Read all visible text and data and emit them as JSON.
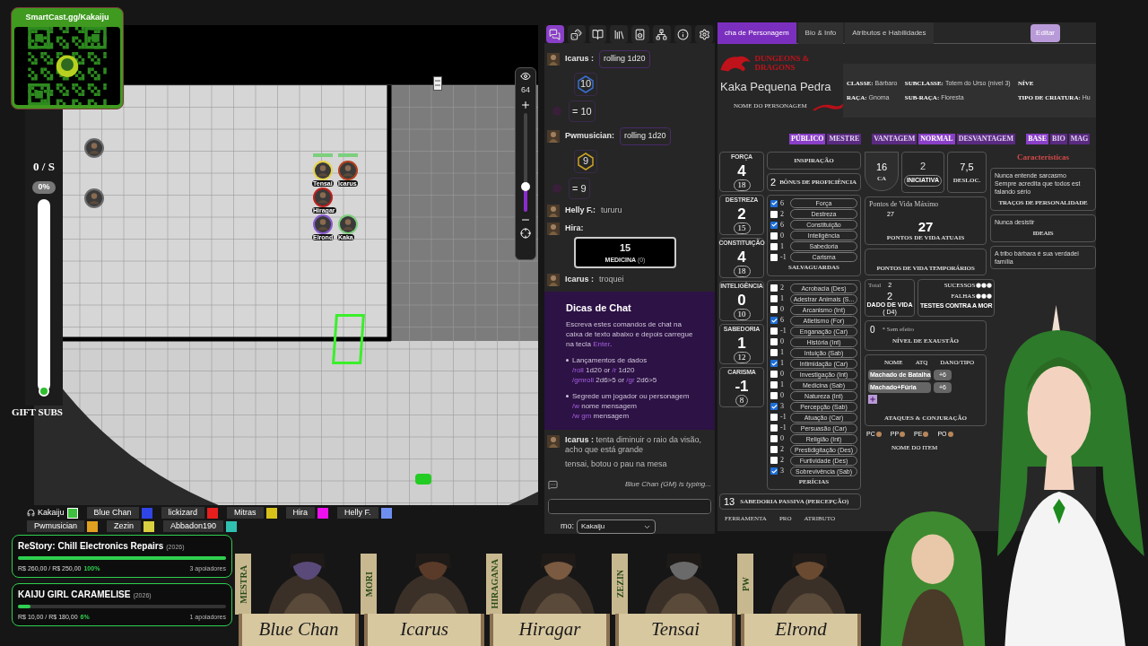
{
  "qr_card": {
    "title": "SmartCast.gg/Kakaiju"
  },
  "map": {
    "tokens": [
      {
        "color": "#6b6b6b"
      },
      {
        "color": "#6b6b6b"
      },
      {
        "color": "#e8d44a",
        "label": "Tensai"
      },
      {
        "color": "#b0401c",
        "label": "Icarus"
      },
      {
        "color": "#c0201c",
        "label": "Hiragar"
      },
      {
        "color": "#8a5ad0",
        "label": "Elrond"
      },
      {
        "color": "#7fd07f",
        "label": "Kaka"
      }
    ],
    "zoom": {
      "value": "64",
      "level": 0.25
    }
  },
  "left_overlay": {
    "counter": "0 / S",
    "percent": "0%",
    "gift_label": "GIFT SUBS",
    "level": 0
  },
  "chat": {
    "toolbar_tabs": [
      {
        "selected": true
      },
      {
        "selected": false
      },
      {
        "selected": false
      },
      {
        "selected": false
      },
      {
        "selected": false
      },
      {
        "selected": false
      },
      {
        "selected": false
      },
      {
        "selected": false
      }
    ],
    "messages": [
      {
        "kind": "roll",
        "author": "Icarus :",
        "text": "rolling 1d20",
        "die": "10",
        "result": "= 10"
      },
      {
        "kind": "roll",
        "author": "Pwmusician:",
        "text": "rolling 1d20",
        "die": "9",
        "result": "= 9"
      },
      {
        "kind": "text",
        "author": "Helly F.:",
        "text": "tururu"
      },
      {
        "kind": "card",
        "author": "Hira:",
        "value": "15",
        "label": "MEDICINA",
        "mod": "(0)"
      },
      {
        "kind": "text",
        "author": "Icarus :",
        "text": "troquei"
      }
    ],
    "tips": {
      "title": "Dicas de Chat",
      "intro": [
        {
          "text": "Escreva estes comandos de chat na caixa de texto abaixo e depois carregue na tecla ",
          "cmd": false
        },
        {
          "text": "Enter",
          "cmd": true
        },
        {
          "text": ".",
          "cmd": false
        }
      ],
      "bullets": [
        {
          "title": "Lançamentos de dados",
          "lines": [
            [
              {
                "text": "/roll",
                "cmd": true
              },
              {
                "text": " 1d20 or ",
                "cmd": false
              },
              {
                "text": "/r",
                "cmd": true
              },
              {
                "text": " 1d20",
                "cmd": false
              }
            ],
            [
              {
                "text": "/gmroll",
                "cmd": true
              },
              {
                "text": " 2d6>5 or ",
                "cmd": false
              },
              {
                "text": "/gr",
                "cmd": true
              },
              {
                "text": " 2d6>5",
                "cmd": false
              }
            ]
          ]
        },
        {
          "title": "Segrede um jogador ou personagem",
          "lines": [
            [
              {
                "text": "/w",
                "cmd": true
              },
              {
                "text": " nome mensagem",
                "cmd": false
              }
            ],
            [
              {
                "text": "/w gm",
                "cmd": true
              },
              {
                "text": " mensagem",
                "cmd": false
              }
            ]
          ]
        }
      ]
    },
    "last_message": {
      "author": "Icarus :",
      "lines": [
        "tenta diminuir o raio da visão, acho que está grande",
        "tensai, botou o pau na mesa"
      ]
    },
    "typing": "Blue Chan (GM) is typing...",
    "as_label": "mo:",
    "as_value": "Kakaiju"
  },
  "sheet": {
    "tabs": [
      {
        "label": "cha de Personagem",
        "selected": true
      },
      {
        "label": "Bio & Info",
        "selected": false
      },
      {
        "label": "Atributos e Habilidades",
        "selected": false
      }
    ],
    "edit_button": "Editar",
    "logo": "DUNGEONS & DRAGONS",
    "character_name": "Kaka Pequena Pedra",
    "character_name_label": "NOME DO PERSONAGEM",
    "info": [
      {
        "label": "CLASSE:",
        "value": "Bárbaro"
      },
      {
        "label": "SUBCLASSE:",
        "value": "Totem do Urso (nível 3)"
      },
      {
        "label": "NÍVE"
      },
      {
        "label": "RAÇA:",
        "value": "Gnoma"
      },
      {
        "label": "SUB-RAÇA:",
        "value": "Floresta"
      },
      {
        "label": "TIPO DE CRIATURA:",
        "value": "Hu"
      }
    ],
    "toggles": [
      {
        "label": "PÚBLICO",
        "selected": true
      },
      {
        "label": "MESTRE",
        "selected": false
      },
      {
        "label": "VANTAGEM",
        "selected": false
      },
      {
        "label": "NORMAL",
        "selected": true
      },
      {
        "label": "DESVANTAGEM",
        "selected": false
      },
      {
        "label": "BASE",
        "selected": true
      },
      {
        "label": "BIO",
        "selected": false
      },
      {
        "label": "MAG",
        "selected": false
      }
    ],
    "abilities": [
      {
        "name": "FORÇA",
        "mod": "4",
        "score": "18"
      },
      {
        "name": "DESTREZA",
        "mod": "2",
        "score": "15"
      },
      {
        "name": "CONSTITUIÇÃO",
        "mod": "4",
        "score": "18"
      },
      {
        "name": "INTELIGÊNCIA",
        "mod": "0",
        "score": "10"
      },
      {
        "name": "SABEDORIA",
        "mod": "1",
        "score": "12"
      },
      {
        "name": "CARISMA",
        "mod": "-1",
        "score": "8"
      }
    ],
    "inspiration": "INSPIRAÇÃO",
    "proficiency": {
      "value": "2",
      "label": "BÔNUS DE PROFICIÊNCIA"
    },
    "saves": [
      {
        "value": "6",
        "name": "Força",
        "checked": true
      },
      {
        "value": "2",
        "name": "Destreza",
        "checked": false
      },
      {
        "value": "6",
        "name": "Constituição",
        "checked": true
      },
      {
        "value": "0",
        "name": "Inteligência",
        "checked": false
      },
      {
        "value": "1",
        "name": "Sabedoria",
        "checked": false
      },
      {
        "value": "-1",
        "name": "Carisma",
        "checked": false
      }
    ],
    "saves_label": "SALVAGUARDAS",
    "skills": [
      {
        "value": "2",
        "name": "Acrobacia (Des)",
        "checked": false
      },
      {
        "value": "1",
        "name": "Adestrar Animais (S...",
        "checked": false
      },
      {
        "value": "0",
        "name": "Arcanismo (Int)",
        "checked": false
      },
      {
        "value": "6",
        "name": "Atletismo (For)",
        "checked": true
      },
      {
        "value": "-1",
        "name": "Enganação (Car)",
        "checked": false
      },
      {
        "value": "0",
        "name": "História (Int)",
        "checked": false
      },
      {
        "value": "1",
        "name": "Intuição (Sab)",
        "checked": false
      },
      {
        "value": "1",
        "name": "Intimidação (Car)",
        "checked": true
      },
      {
        "value": "0",
        "name": "Investigação (Int)",
        "checked": false
      },
      {
        "value": "1",
        "name": "Medicina (Sab)",
        "checked": false
      },
      {
        "value": "0",
        "name": "Natureza (Int)",
        "checked": false
      },
      {
        "value": "3",
        "name": "Percepção (Sab)",
        "checked": true
      },
      {
        "value": "-1",
        "name": "Atuação (Car)",
        "checked": false
      },
      {
        "value": "-1",
        "name": "Persuasão (Car)",
        "checked": false
      },
      {
        "value": "0",
        "name": "Religião (Int)",
        "checked": false
      },
      {
        "value": "2",
        "name": "Prestidigitação (Des)",
        "checked": false
      },
      {
        "value": "2",
        "name": "Furtividade (Des)",
        "checked": false
      },
      {
        "value": "3",
        "name": "Sobrevivência (Sab)",
        "checked": true
      }
    ],
    "skills_label": "PERÍCIAS",
    "passive": {
      "value": "13",
      "label": "SABEDORIA PASSIVA (PERCEPÇÃO)"
    },
    "tools_columns": [
      "FERRAMENTA",
      "PRO",
      "ATRIBUTO"
    ],
    "armor": {
      "value": "16",
      "label": "CA"
    },
    "initiative": {
      "value": "2",
      "label": "INICIATIVA"
    },
    "speed": {
      "value": "7,5",
      "label": "DESLOC."
    },
    "hp": {
      "max_label": "Pontos de Vida Máximo",
      "max": "27",
      "current": "27",
      "current_label": "PONTOS DE VIDA ATUAIS",
      "temp_label": "PONTOS DE VIDA TEMPORÁRIOS"
    },
    "hit_dice": {
      "total_label": "Total",
      "total": "2",
      "value": "2",
      "label": "DADO DE VIDA",
      "die": "( D4)"
    },
    "death_saves": {
      "successes_label": "SUCESSOS",
      "failures_label": "FALHAS",
      "label": "TESTES CONTRA A MOR"
    },
    "exhaustion": {
      "value": "0",
      "note": "* Sem efeito",
      "label": "NÍVEL DE EXAUSTÃO"
    },
    "attacks": {
      "columns": [
        "NOME",
        "ATQ",
        "DANO/TIPO"
      ],
      "rows": [
        {
          "name": "Machado de Batalha",
          "attack": "+6"
        },
        {
          "name": "Machado+Fúria",
          "attack": "+6"
        }
      ],
      "label": "ATAQUES & CONJURAÇÃO"
    },
    "coins": [
      "PC",
      "PP",
      "PE",
      "PO"
    ],
    "items_label": "NOME DO ITEM",
    "traits_title": "Características",
    "traits": [
      {
        "lines": [
          "Nunca entende sarcasmo",
          "Sempre acredita que todos est",
          "falando sério"
        ],
        "label": "TRAÇOS DE PERSONALIDADE"
      },
      {
        "lines": [
          "Nunca desistir"
        ],
        "label": "IDEAIS"
      },
      {
        "lines": [
          "A tribo bárbara é sua verdadei",
          "família"
        ]
      }
    ]
  },
  "players": [
    {
      "name": "Kakaiju",
      "color": "#3fbf3f",
      "self": true
    },
    {
      "name": "Blue Chan",
      "color": "#2f45e6",
      "self": false
    },
    {
      "name": "lickizard",
      "color": "#e61e1e",
      "self": false
    },
    {
      "name": "Mitras",
      "color": "#d8c21a",
      "self": false
    },
    {
      "name": "Hira",
      "color": "#ee10ee",
      "self": false
    },
    {
      "name": "Helly F.",
      "color": "#6f8ff0",
      "self": false
    },
    {
      "name": "Pwmusician",
      "color": "#e0a020",
      "self": false
    },
    {
      "name": "Zezin",
      "color": "#d8d040",
      "self": false
    },
    {
      "name": "Abbadon190",
      "color": "#30c0b0",
      "self": false
    }
  ],
  "goals": [
    {
      "title": "ReStory: Chill Electronics Repairs",
      "year": "(2026)",
      "amount": "R$ 260,00 / R$ 250,00",
      "percent": "100%",
      "supporters": "3 apoiadores",
      "level": 1
    },
    {
      "title": "KAIJU GIRL CARAMELISE",
      "year": "(2026)",
      "amount": "R$ 10,00 / R$ 180,00",
      "percent": "6%",
      "supporters": "1 apoiadores",
      "level": 0.06
    }
  ],
  "portraits": [
    {
      "role": "MESTRA",
      "name": "Blue Chan"
    },
    {
      "role": "MORI",
      "name": "Icarus"
    },
    {
      "role": "HIRAGANA",
      "name": "Hiragar"
    },
    {
      "role": "ZEZIN",
      "name": "Tensai"
    },
    {
      "role": "PW",
      "name": "Elrond"
    }
  ]
}
